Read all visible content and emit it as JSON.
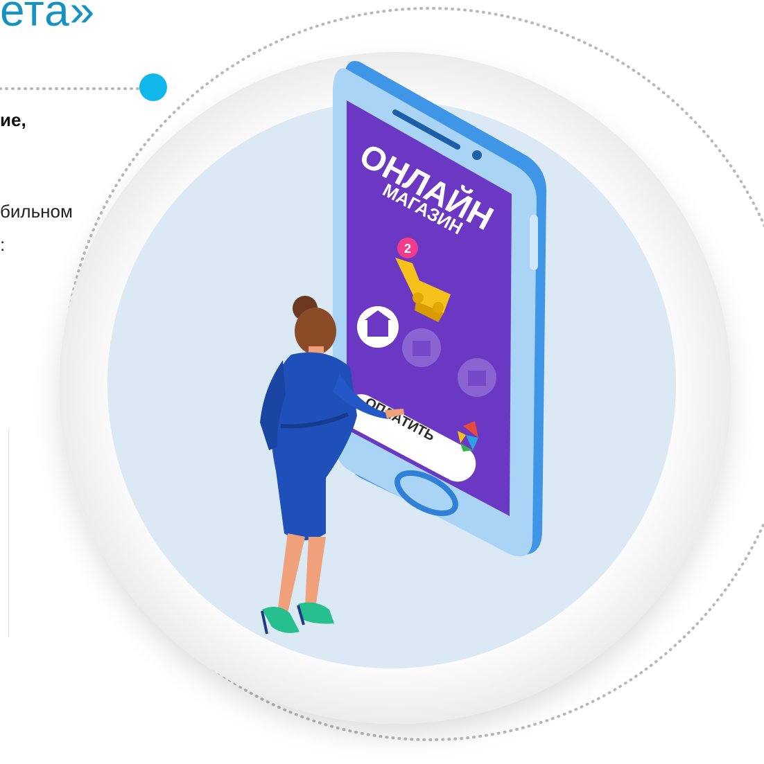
{
  "slide": {
    "title_fragment": "ета»",
    "body_bold_fragment": "ие,",
    "body_line1_fragment": "бильном",
    "body_line2_fragment": ":"
  },
  "phone_screen": {
    "heading": "ОНЛАЙН",
    "subheading": "МАГАЗИН",
    "cart_badge": "2",
    "pay_button_label": "ОПЛАТИТЬ"
  },
  "colors": {
    "accent": "#1492c4",
    "dot_accent": "#10b7ea",
    "screen_purple": "#6a38c2",
    "phone_body": "#5aaef5",
    "dress_blue": "#1f4fb8",
    "shoe_green": "#25c08e"
  },
  "icons": [
    "bank-icon",
    "cart-icon",
    "logo-icon"
  ]
}
